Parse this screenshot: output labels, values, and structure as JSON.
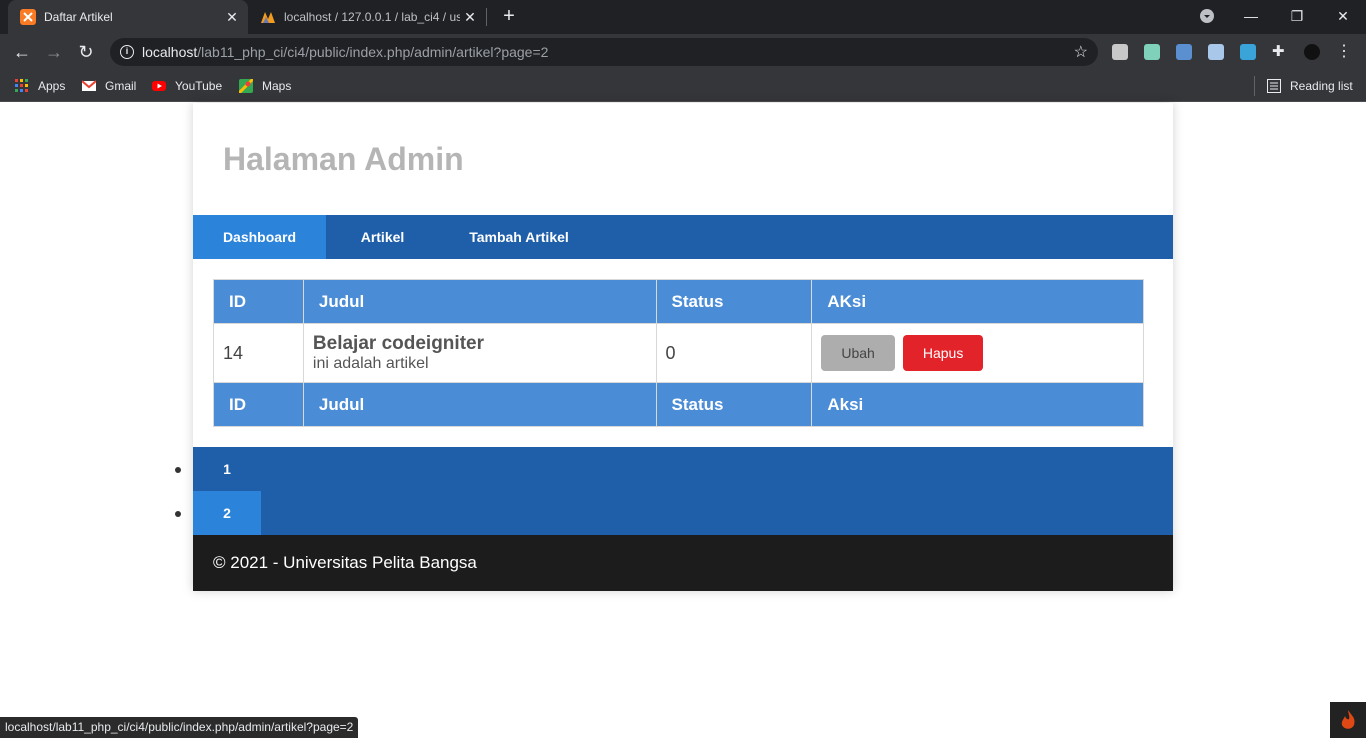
{
  "browser": {
    "tabs": [
      {
        "title": "Daftar Artikel",
        "active": true
      },
      {
        "title": "localhost / 127.0.0.1 / lab_ci4 / us",
        "active": false
      }
    ],
    "address": {
      "host": "localhost",
      "path": "/lab11_php_ci/ci4/public/index.php/admin/artikel?page=2"
    },
    "bookmarks": [
      {
        "label": "Apps",
        "icon": "apps-grid-icon"
      },
      {
        "label": "Gmail",
        "icon": "gmail-icon"
      },
      {
        "label": "YouTube",
        "icon": "youtube-icon"
      },
      {
        "label": "Maps",
        "icon": "maps-icon"
      }
    ],
    "reading_list": "Reading list",
    "status_url": "localhost/lab11_php_ci/ci4/public/index.php/admin/artikel?page=2"
  },
  "page": {
    "title": "Halaman Admin",
    "nav": [
      {
        "label": "Dashboard",
        "active": true
      },
      {
        "label": "Artikel",
        "active": false
      },
      {
        "label": "Tambah Artikel",
        "active": false
      }
    ],
    "table": {
      "head": [
        "ID",
        "Judul",
        "Status",
        "AKsi"
      ],
      "foot": [
        "ID",
        "Judul",
        "Status",
        "Aksi"
      ],
      "rows": [
        {
          "id": "14",
          "judul": "Belajar codeigniter",
          "isi": "ini adalah artikel",
          "status": "0",
          "ubah": "Ubah",
          "hapus": "Hapus"
        }
      ]
    },
    "pagination": [
      {
        "label": "1",
        "active": false
      },
      {
        "label": "2",
        "active": true
      }
    ],
    "footer": "© 2021 - Universitas Pelita Bangsa"
  },
  "colors": {
    "nav_bg": "#1f5faa",
    "nav_active": "#2b83da",
    "table_head": "#4a8cd6",
    "delete_button": "#e3232a",
    "footer_bg": "#1c1c1c"
  }
}
